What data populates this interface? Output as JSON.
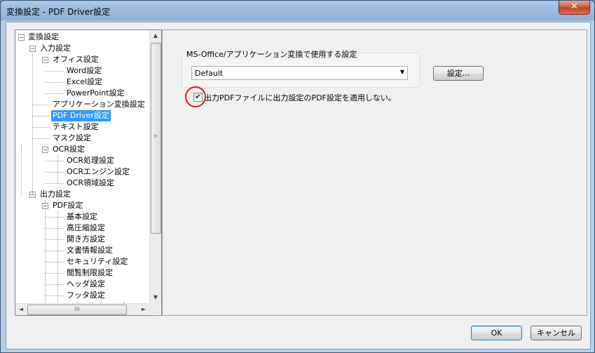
{
  "window": {
    "title": "変換設定 - PDF Driver設定",
    "close_glyph": "✕"
  },
  "tree": {
    "nodes": [
      {
        "label": "変換設定",
        "level": 0,
        "expander": "−"
      },
      {
        "label": "入力設定",
        "level": 1,
        "expander": "−"
      },
      {
        "label": "オフィス設定",
        "level": 2,
        "expander": "−"
      },
      {
        "label": "Word設定",
        "level": 3
      },
      {
        "label": "Excel設定",
        "level": 3
      },
      {
        "label": "PowerPoint設定",
        "level": 3
      },
      {
        "label": "アプリケーション変換設定",
        "level": 2
      },
      {
        "label": "PDF Driver設定",
        "level": 2,
        "selected": true
      },
      {
        "label": "テキスト設定",
        "level": 2
      },
      {
        "label": "マスク設定",
        "level": 2
      },
      {
        "label": "OCR設定",
        "level": 2,
        "expander": "−"
      },
      {
        "label": "OCR処理設定",
        "level": 3
      },
      {
        "label": "OCRエンジン設定",
        "level": 3
      },
      {
        "label": "OCR領域設定",
        "level": 3
      },
      {
        "label": "出力設定",
        "level": 1,
        "expander": "−"
      },
      {
        "label": "PDF設定",
        "level": 2,
        "expander": "−"
      },
      {
        "label": "基本設定",
        "level": 3
      },
      {
        "label": "高圧縮設定",
        "level": 3
      },
      {
        "label": "開き方設定",
        "level": 3
      },
      {
        "label": "文書情報設定",
        "level": 3
      },
      {
        "label": "セキュリティ設定",
        "level": 3
      },
      {
        "label": "閲覧制限設定",
        "level": 3
      },
      {
        "label": "ヘッダ設定",
        "level": 3
      },
      {
        "label": "フッタ設定",
        "level": 3
      },
      {
        "label": "テキストウォーターマーク",
        "level": 3
      }
    ]
  },
  "scrollbar": {
    "up": "▲",
    "down": "▼",
    "left": "◄",
    "right": "►",
    "grip": "≡",
    "hgrip": "III"
  },
  "settings": {
    "group_label": "MS-Office/アプリケーション変換で使用する設定",
    "combo_value": "Default",
    "combo_arrow": "▼",
    "settings_button": "設定...",
    "checkbox_checked": true,
    "checkbox_mark": "✔",
    "checkbox_label": "出力PDFファイルに出力設定のPDF設定を適用しない。"
  },
  "footer": {
    "ok": "OK",
    "cancel": "キャンセル"
  },
  "colors": {
    "selection": "#3399ff",
    "highlight_circle": "#e31b23",
    "titlebar": "#a9c6e6"
  }
}
